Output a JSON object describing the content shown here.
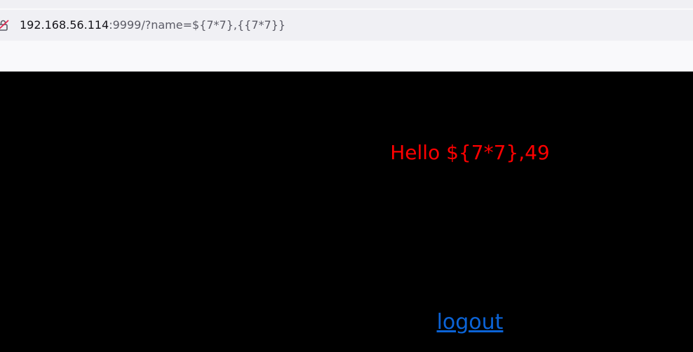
{
  "browser": {
    "url_host": "192.168.56.114",
    "url_rest": ":9999/?name=${7*7},{{7*7}}"
  },
  "page": {
    "greeting": "Hello ${7*7},49",
    "logout_label": "logout"
  },
  "colors": {
    "page_background": "#000000",
    "greeting_text": "#ff0000",
    "link": "#0b63d6"
  },
  "icons": {
    "address_bar_left": "insecure-lock-icon"
  }
}
